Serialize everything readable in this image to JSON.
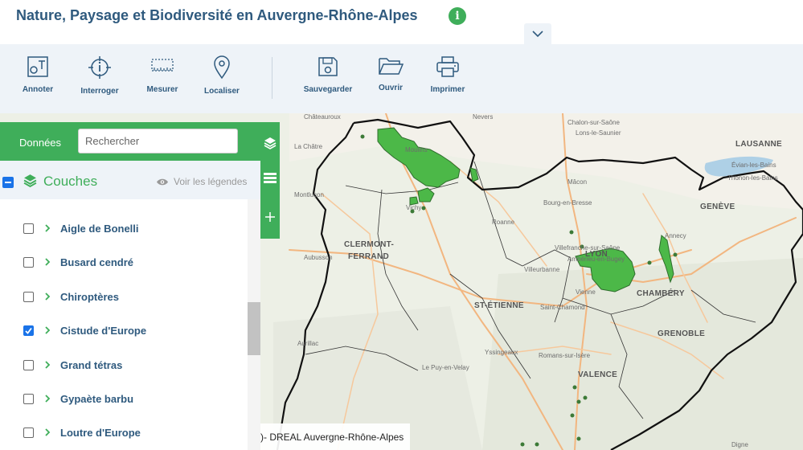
{
  "app": {
    "title": "Nature, Paysage et Biodiversité en Auvergne-Rhône-Alpes",
    "info_icon": "info-icon",
    "collapse_icon": "chevron-down-icon"
  },
  "toolbar": {
    "tools": [
      {
        "label": "Annoter",
        "icon": "annotate-icon"
      },
      {
        "label": "Interroger",
        "icon": "query-icon"
      },
      {
        "label": "Mesurer",
        "icon": "ruler-icon"
      },
      {
        "label": "Localiser",
        "icon": "map-pin-icon"
      },
      {
        "label": "Sauvegarder",
        "icon": "save-icon"
      },
      {
        "label": "Ouvrir",
        "icon": "folder-open-icon"
      },
      {
        "label": "Imprimer",
        "icon": "printer-icon"
      }
    ]
  },
  "panel": {
    "tab_label": "Données",
    "search_placeholder": "Rechercher",
    "couches_label": "Couches",
    "legend_toggle_label": "Voir les légendes",
    "layers": [
      {
        "label": "Aigle de Bonelli",
        "checked": false
      },
      {
        "label": "Busard cendré",
        "checked": false
      },
      {
        "label": "Chiroptères",
        "checked": false
      },
      {
        "label": "Cistude d'Europe",
        "checked": true
      },
      {
        "label": "Grand tétras",
        "checked": false
      },
      {
        "label": "Gypaète barbu",
        "checked": false
      },
      {
        "label": "Loutre d'Europe",
        "checked": false
      }
    ]
  },
  "map": {
    "cities": [
      "CLERMONT-",
      "FERRAND",
      "ST-ÉTIENNE",
      "GENÈVE",
      "CHAMBÉRY",
      "GRENOBLE",
      "VALENCE",
      "LAUSANNE",
      "LYON"
    ],
    "places": [
      "Châteauroux",
      "Moulins",
      "Vichy",
      "Montluçon",
      "Roanne",
      "Villeurbanne",
      "Vienne",
      "Mâcon",
      "Bourg-en-Bresse",
      "Annecy",
      "Thonon-les-Bains",
      "Évian-les-Bains",
      "Le Puy-en-Velay",
      "Romans-sur-Isère",
      "Aurillac",
      "Yssingeaux",
      "Chalon-sur-Saône",
      "Lons-le-Saunier",
      "Saint-Chamond",
      "Aubusson",
      "La Châtre",
      "Nevers",
      "Digne",
      "Ambérieu-en-Bugey",
      "Villefranche-sur-Saône"
    ],
    "attribution": ")- DREAL Auvergne-Rhône-Alpes",
    "colors": {
      "protected_area": "#4cb848",
      "boundary": "#111111"
    }
  }
}
